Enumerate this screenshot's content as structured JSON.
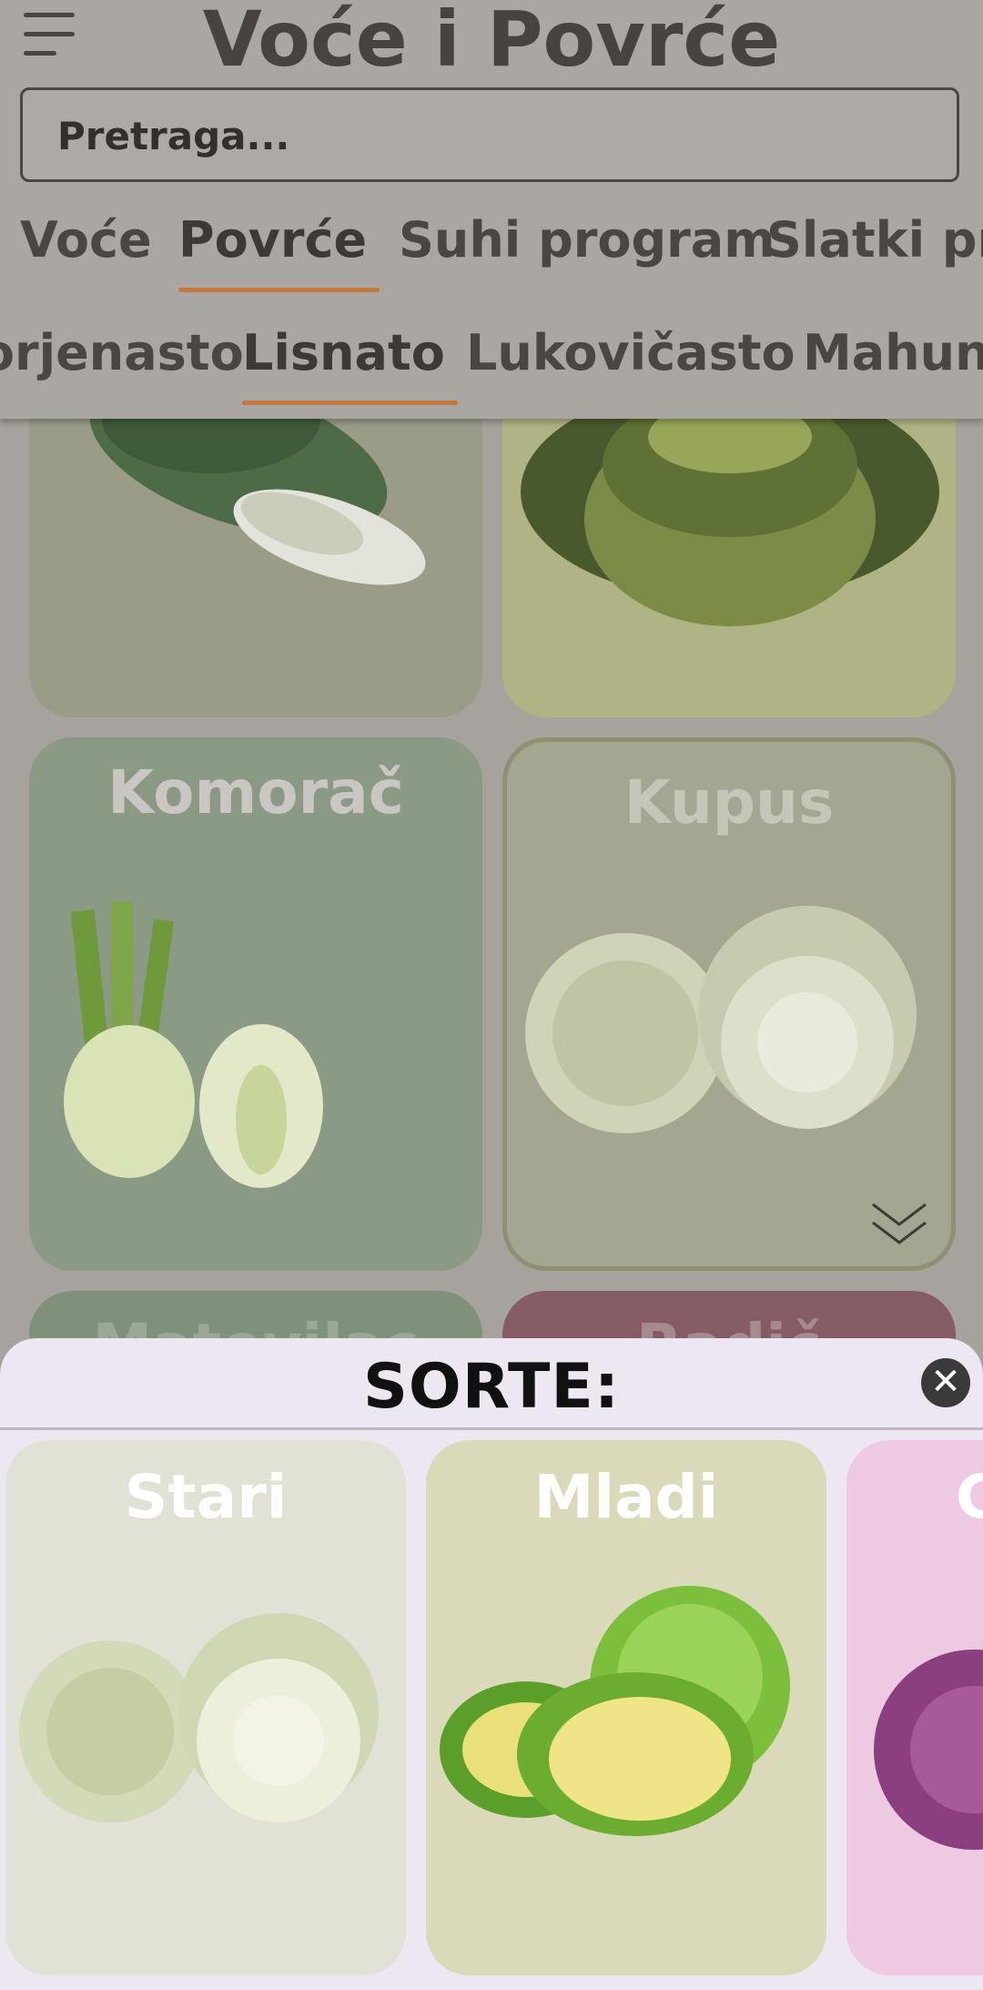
{
  "header": {
    "title": "Voće i Povrće"
  },
  "search": {
    "placeholder": "Pretraga..."
  },
  "categories": [
    {
      "label": "Voće"
    },
    {
      "label": "Povrće"
    },
    {
      "label": "Suhi program"
    },
    {
      "label": "Slatki program"
    }
  ],
  "subcategories": [
    {
      "label": "Korjenasto"
    },
    {
      "label": "Lisnato"
    },
    {
      "label": "Lukovičasto"
    },
    {
      "label": "Mahunarke"
    }
  ],
  "products": [
    {
      "name": "Komorač"
    },
    {
      "name": "Kupus"
    },
    {
      "name": "Matovilac"
    },
    {
      "name": "Radič"
    }
  ],
  "sheet": {
    "title": "SORTE:",
    "close_icon": "close-icon",
    "varieties": [
      {
        "name": "Stari"
      },
      {
        "name": "Mladi"
      },
      {
        "name": "Crveni"
      }
    ]
  },
  "colors": {
    "accent": "#c4783d"
  }
}
